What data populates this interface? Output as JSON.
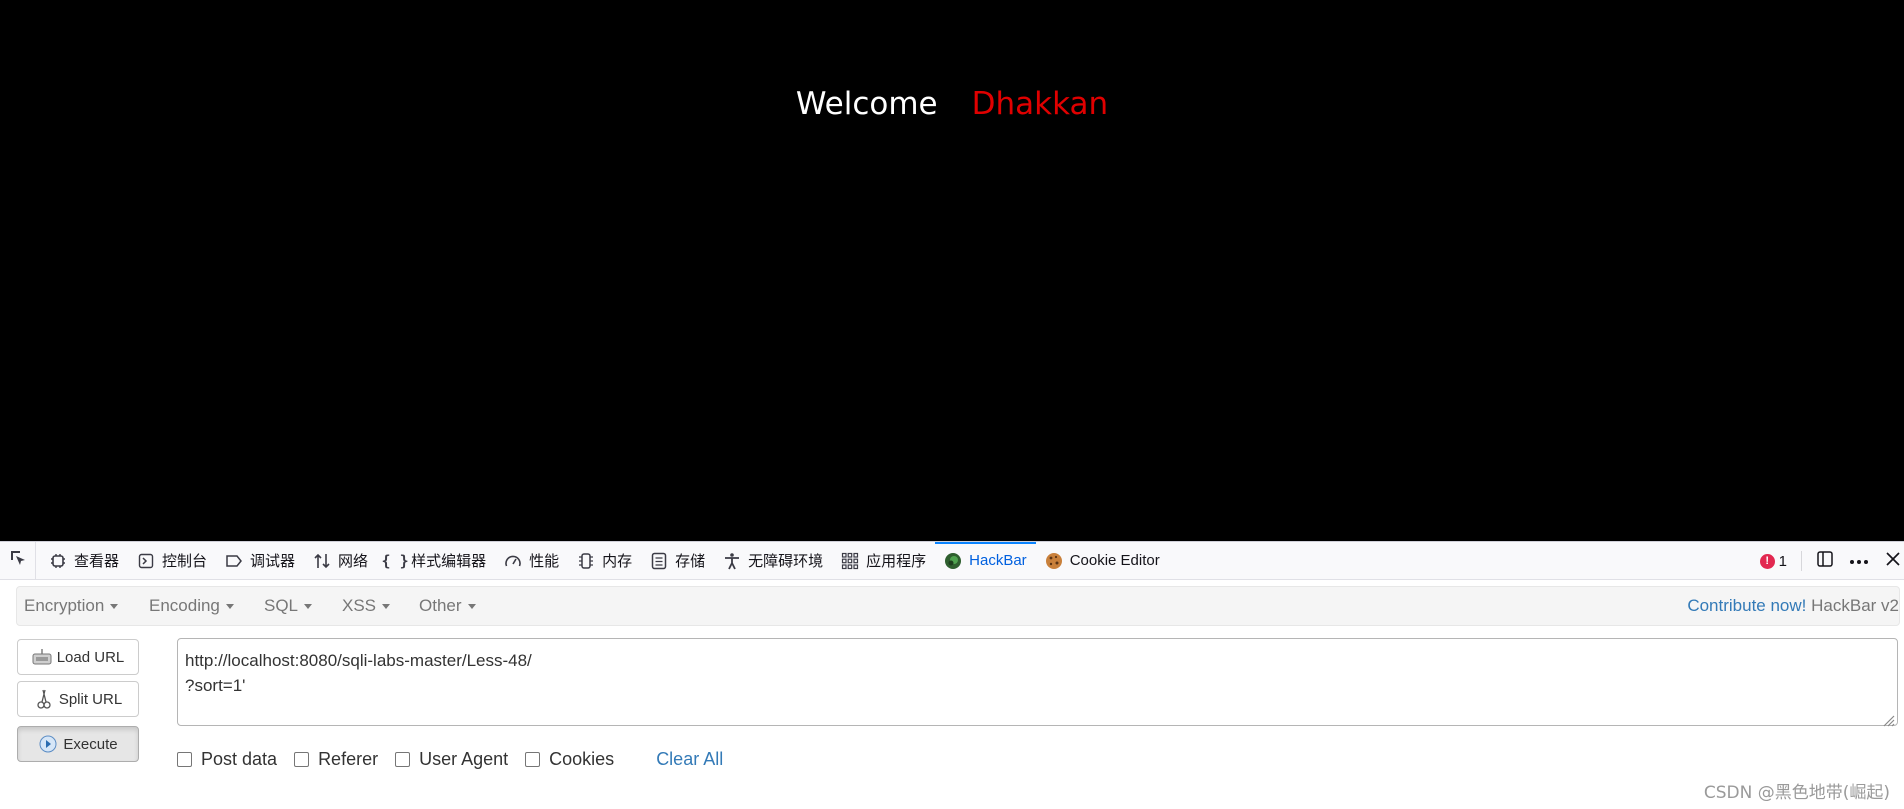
{
  "page": {
    "welcome": "Welcome",
    "username": "Dhakkan"
  },
  "devtools": {
    "tabs": [
      {
        "label": "查看器",
        "icon": "inspector-icon"
      },
      {
        "label": "控制台",
        "icon": "console-icon"
      },
      {
        "label": "调试器",
        "icon": "debugger-icon"
      },
      {
        "label": "网络",
        "icon": "network-icon"
      },
      {
        "label": "样式编辑器",
        "icon": "style-editor-icon"
      },
      {
        "label": "性能",
        "icon": "performance-icon"
      },
      {
        "label": "内存",
        "icon": "memory-icon"
      },
      {
        "label": "存储",
        "icon": "storage-icon"
      },
      {
        "label": "无障碍环境",
        "icon": "accessibility-icon"
      },
      {
        "label": "应用程序",
        "icon": "application-icon"
      },
      {
        "label": "HackBar",
        "icon": "hackbar-icon",
        "active": true
      },
      {
        "label": "Cookie Editor",
        "icon": "cookie-icon"
      }
    ],
    "error_count": "1"
  },
  "hackbar": {
    "menus": {
      "encryption": "Encryption",
      "encoding": "Encoding",
      "sql": "SQL",
      "xss": "XSS",
      "other": "Other"
    },
    "contribute_link": "Contribute now!",
    "version": "HackBar v2",
    "buttons": {
      "load_url": "Load URL",
      "split_url": "Split URL",
      "execute": "Execute"
    },
    "url_lines": [
      "http://localhost:8080/sqli-labs-master/Less-48/",
      "?sort=1'"
    ],
    "options": {
      "post_data": "Post data",
      "referer": "Referer",
      "user_agent": "User Agent",
      "cookies": "Cookies"
    },
    "clear_all": "Clear All"
  },
  "watermark": "CSDN @黑色地带(崛起)",
  "colors": {
    "viewport_bg": "#000000",
    "username": "#e00000",
    "link": "#337ab7",
    "active_tab": "#0060df"
  }
}
